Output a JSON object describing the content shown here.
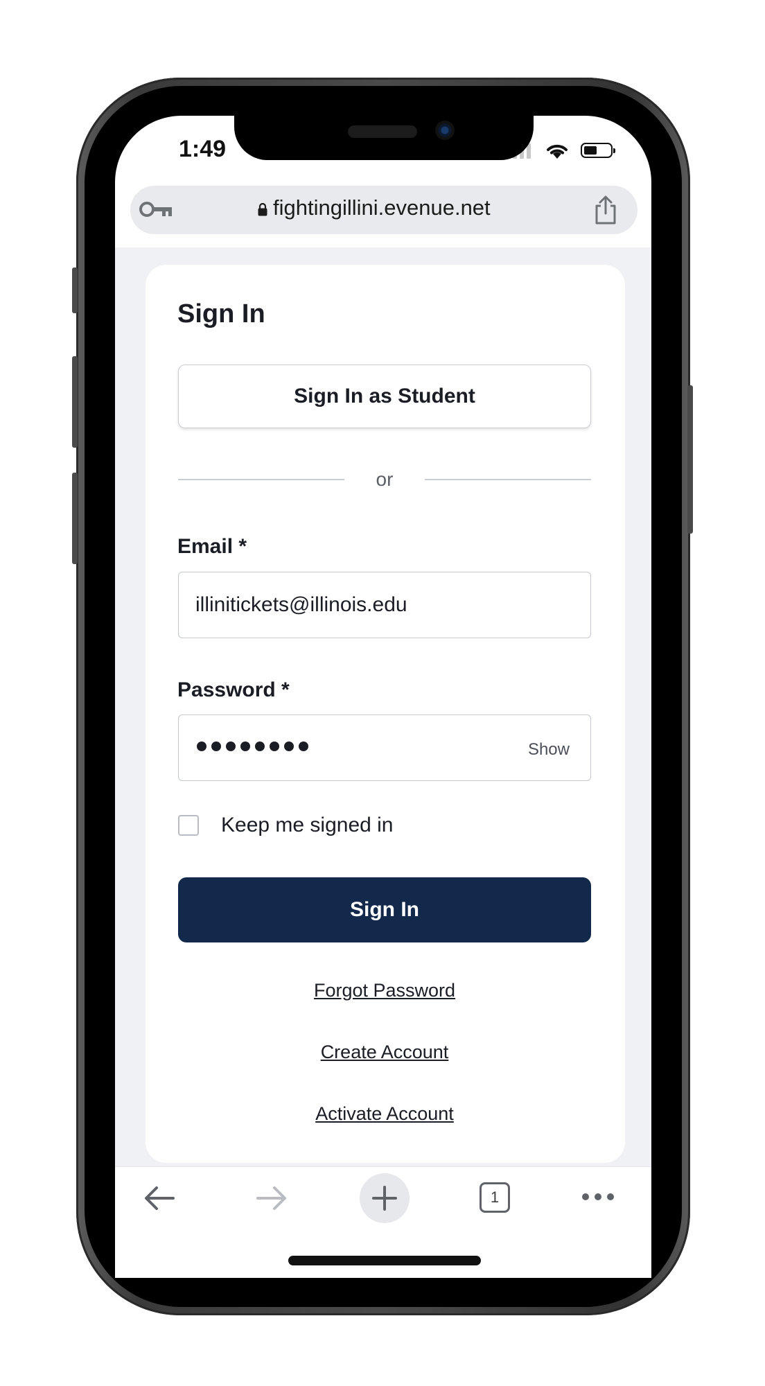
{
  "status_bar": {
    "time": "1:49"
  },
  "browser": {
    "url": "fightingillini.evenue.net",
    "tab_count": "1"
  },
  "form": {
    "title": "Sign In",
    "student_button": "Sign In as Student",
    "divider_text": "or",
    "email_label": "Email *",
    "email_value": "illinitickets@illinois.edu",
    "password_label": "Password *",
    "password_masked_length": 8,
    "show_label": "Show",
    "keep_signed_in_label": "Keep me signed in",
    "keep_signed_in_checked": false,
    "submit_button": "Sign In",
    "links": {
      "forgot_password": "Forgot Password",
      "create_account": "Create Account",
      "activate_account": "Activate Account"
    }
  },
  "colors": {
    "primary_button": "#13294b",
    "page_background": "#eff1f5"
  }
}
